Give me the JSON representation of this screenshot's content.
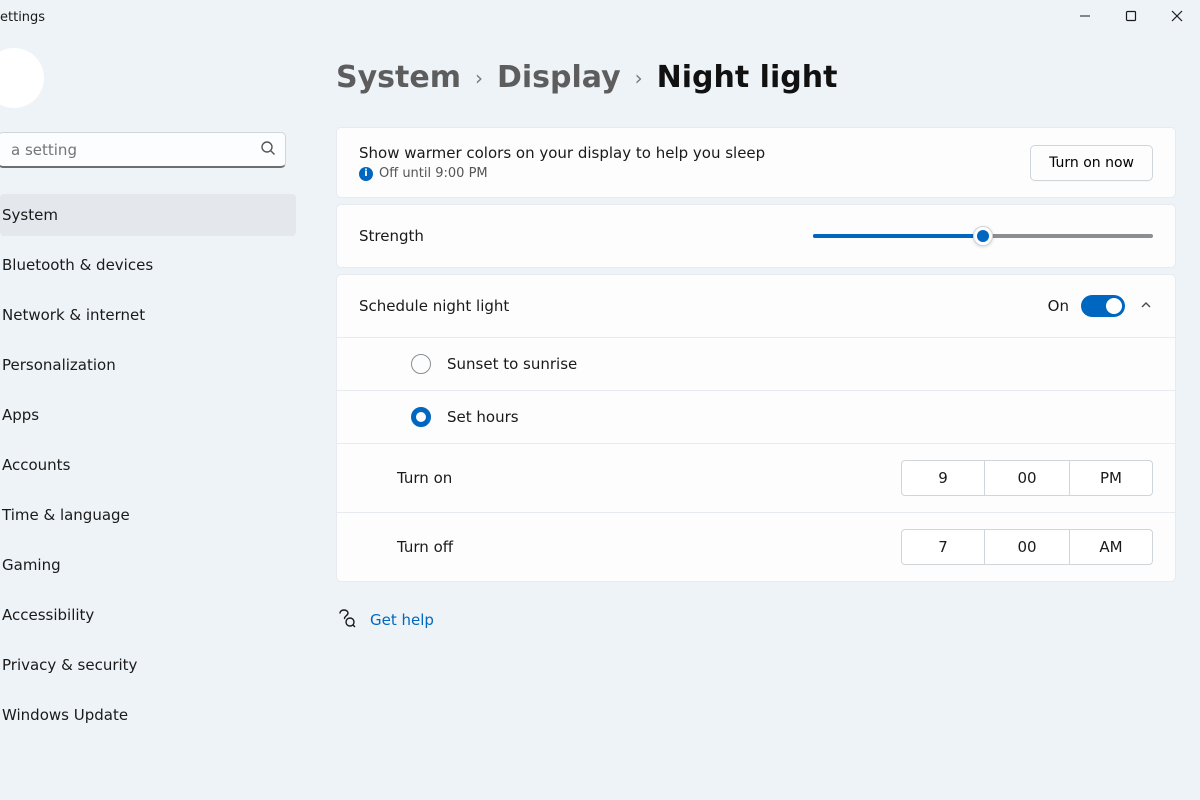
{
  "window": {
    "app_title": "ettings"
  },
  "search": {
    "placeholder": "a setting"
  },
  "nav": {
    "items": [
      {
        "label": "System",
        "selected": true
      },
      {
        "label": "Bluetooth & devices"
      },
      {
        "label": "Network & internet"
      },
      {
        "label": "Personalization"
      },
      {
        "label": "Apps"
      },
      {
        "label": "Accounts"
      },
      {
        "label": "Time & language"
      },
      {
        "label": "Gaming"
      },
      {
        "label": "Accessibility"
      },
      {
        "label": "Privacy & security"
      },
      {
        "label": "Windows Update"
      }
    ]
  },
  "breadcrumb": {
    "a": "System",
    "b": "Display",
    "current": "Night light"
  },
  "panel": {
    "desc": "Show warmer colors on your display to help you sleep",
    "status": "Off until 9:00 PM",
    "turn_on_btn": "Turn on now",
    "strength_label": "Strength",
    "strength_pct": 50,
    "schedule_label": "Schedule night light",
    "schedule_state": "On",
    "radio_sunset": "Sunset to sunrise",
    "radio_sethours": "Set hours",
    "turn_on_label": "Turn on",
    "turn_on_time": {
      "hour": "9",
      "minute": "00",
      "ampm": "PM"
    },
    "turn_off_label": "Turn off",
    "turn_off_time": {
      "hour": "7",
      "minute": "00",
      "ampm": "AM"
    }
  },
  "help": {
    "label": "Get help"
  }
}
